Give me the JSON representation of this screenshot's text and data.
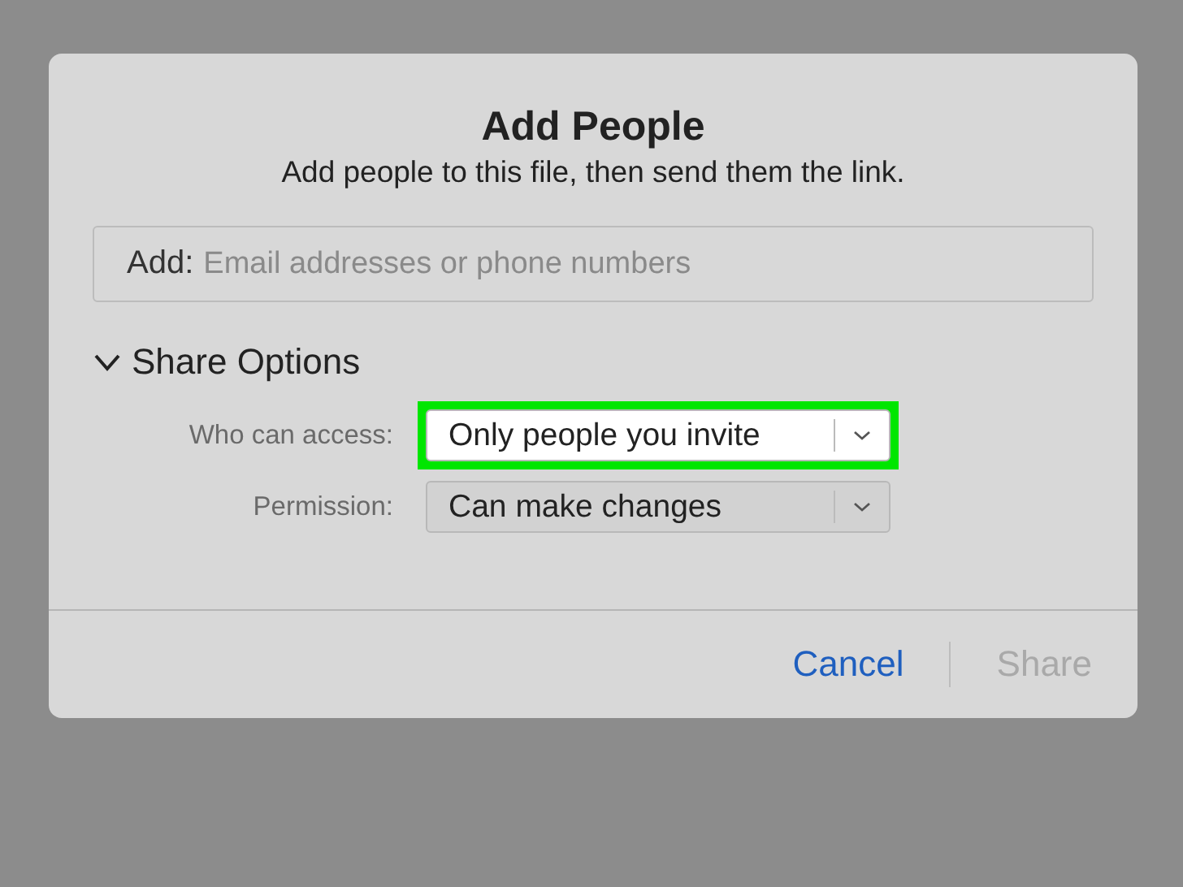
{
  "dialog": {
    "title": "Add People",
    "subtitle": "Add people to this file, then send them the link.",
    "add_field": {
      "label": "Add:",
      "placeholder": "Email addresses or phone numbers"
    },
    "share_options": {
      "label": "Share Options",
      "expanded": true,
      "rows": [
        {
          "label": "Who can access:",
          "value": "Only people you invite",
          "highlighted": true
        },
        {
          "label": "Permission:",
          "value": "Can make changes",
          "highlighted": false
        }
      ]
    },
    "buttons": [
      {
        "label": "Cancel",
        "disabled": false
      },
      {
        "label": "Share",
        "disabled": true
      }
    ]
  }
}
